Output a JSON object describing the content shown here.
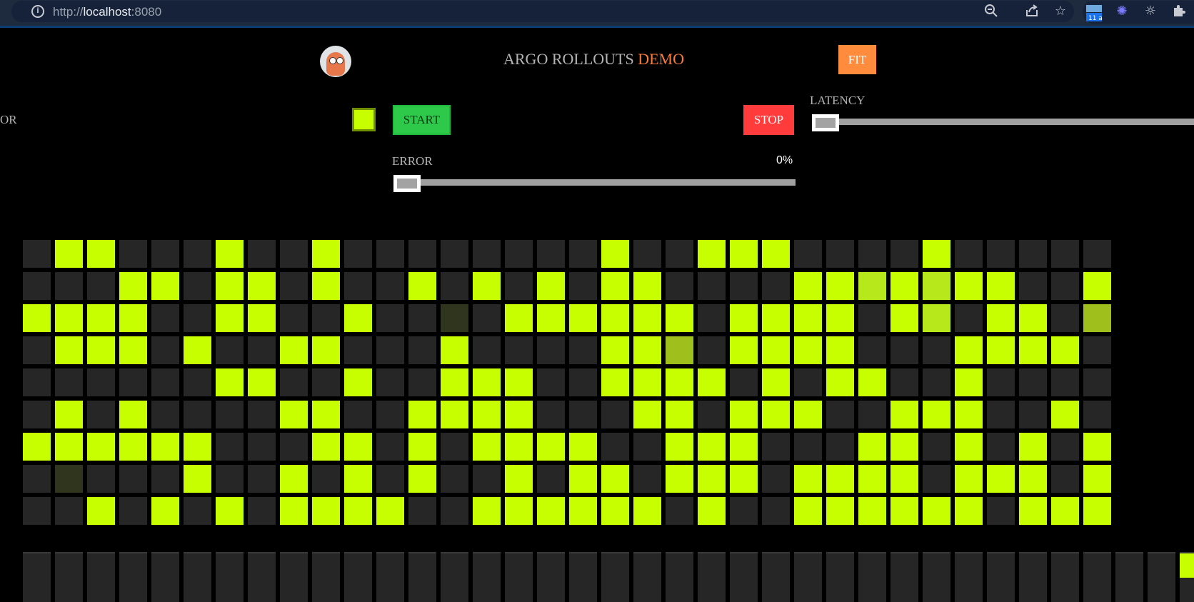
{
  "browser": {
    "url_prefix": "http://",
    "url_host": "localhost",
    "url_port": ":8080",
    "icons": [
      "info-icon",
      "zoom-out-icon",
      "share-icon",
      "star-icon",
      "calendar-extension-icon",
      "sparkle-extension-icon",
      "sun-extension-icon",
      "puzzle-icon"
    ],
    "calendar_badge": "11 a"
  },
  "header": {
    "title_main": "ARGO ROLLOUTS",
    "title_accent": "DEMO",
    "fit_label": "FIT"
  },
  "controls": {
    "color_label": "OR",
    "start_label": "START",
    "stop_label": "STOP",
    "error_label": "ERROR",
    "error_value": "0%",
    "latency_label": "LATENCY",
    "error_slider_value": 0,
    "latency_slider_value": 0
  },
  "colors": {
    "accent": "#c8ff00",
    "empty": "#262626",
    "start": "#2ec84a",
    "stop": "#ff3b3b",
    "fit": "#ff8c3c",
    "title_accent": "#ff7a36"
  },
  "grid": {
    "rows": [
      "0110001001000000001001110000100000",
      "0001101101001010101100001121211001",
      "1111001100100d01111110111101201103",
      "0111010011000100001130111100011110",
      "0000001100100111001111010110010000",
      "0101000011001111000110111001110010",
      "1111110001101011110011100011010101",
      "0d00010010101001011011101111011101",
      "0010101011110011111101001111110111"
    ],
    "legend": {
      "0": "empty",
      "1": "full",
      "2": "light",
      "3": "dim",
      "d": "dark"
    }
  },
  "bars": {
    "fill_fractions": [
      0,
      0,
      0,
      0,
      0,
      0,
      0,
      0,
      0,
      0,
      0,
      0,
      0,
      0,
      0,
      0,
      0,
      0,
      0,
      0,
      0,
      0,
      0,
      0,
      0,
      0,
      0,
      0,
      0,
      0,
      0,
      0,
      0,
      0,
      0,
      0,
      0.5
    ]
  }
}
